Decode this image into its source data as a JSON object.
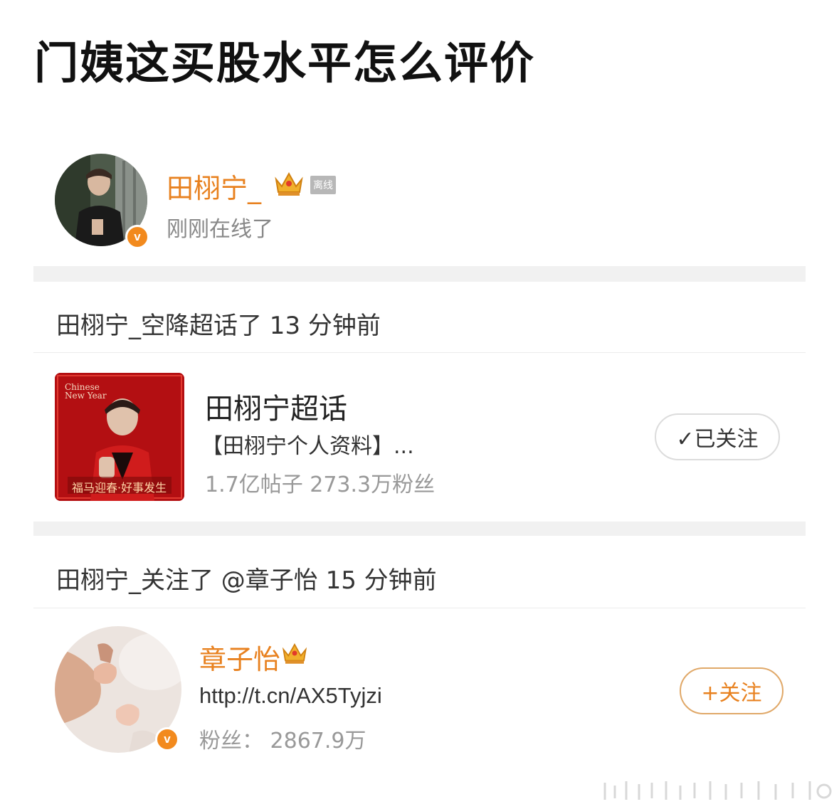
{
  "headline": "门姨这买股水平怎么评价",
  "profile": {
    "name": "田栩宁_",
    "status_tag": "离线",
    "status_text": "刚刚在线了",
    "verified_badge": "v"
  },
  "activity1": {
    "text": "田栩宁_空降超话了 13 分钟前"
  },
  "topic": {
    "thumb_text_en_1": "Chinese",
    "thumb_text_en_2": "New Year",
    "thumb_text_banner": "福马迎春·好事发生",
    "title": "田栩宁超话",
    "description": "【田栩宁个人资料】...",
    "stats": "1.7亿帖子  273.3万粉丝",
    "followed_label": "✓已关注"
  },
  "activity2": {
    "text": "田栩宁_关注了 @章子怡 15 分钟前"
  },
  "user2": {
    "name": "章子怡",
    "link": "http://t.cn/AX5Tyjzi",
    "fans": "粉丝：  2867.9万",
    "follow_label": "+关注",
    "verified_badge": "v"
  },
  "colors": {
    "accent_orange": "#e8811f",
    "badge_orange": "#f28a1e",
    "band_gray": "#f1f1f1",
    "topic_red": "#b30f12"
  },
  "icons": [
    "crown-icon",
    "verified-icon",
    "check-icon",
    "plus-icon"
  ]
}
